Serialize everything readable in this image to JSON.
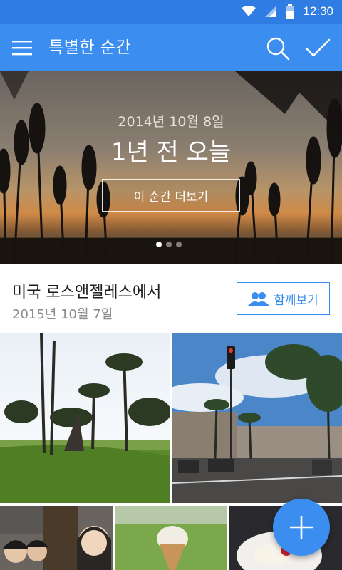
{
  "status_bar": {
    "time": "12:30",
    "icons": [
      "wifi-icon",
      "signal-icon",
      "battery-icon"
    ]
  },
  "app_bar": {
    "title": "특별한 순간",
    "icons": [
      "menu-icon",
      "search-icon",
      "check-icon"
    ],
    "color": "#3b8ef0"
  },
  "hero": {
    "date": "2014년 10월 8일",
    "headline": "1년 전 오늘",
    "more_button": "이 순간 더보기",
    "page_count": 3,
    "active_page": 1
  },
  "section": {
    "location": "미국 로스앤젤레스에서",
    "date": "2015년 10월 7일",
    "share_button": "함께보기",
    "share_icon": "people-icon"
  },
  "photos": [
    {
      "name": "photo-palm-park"
    },
    {
      "name": "photo-street-traffic-light"
    },
    {
      "name": "photo-selfie-group"
    },
    {
      "name": "photo-ice-cream-cone"
    },
    {
      "name": "photo-dessert-plate"
    }
  ],
  "fab": {
    "icon": "plus-icon",
    "color": "#3b8ef0"
  }
}
